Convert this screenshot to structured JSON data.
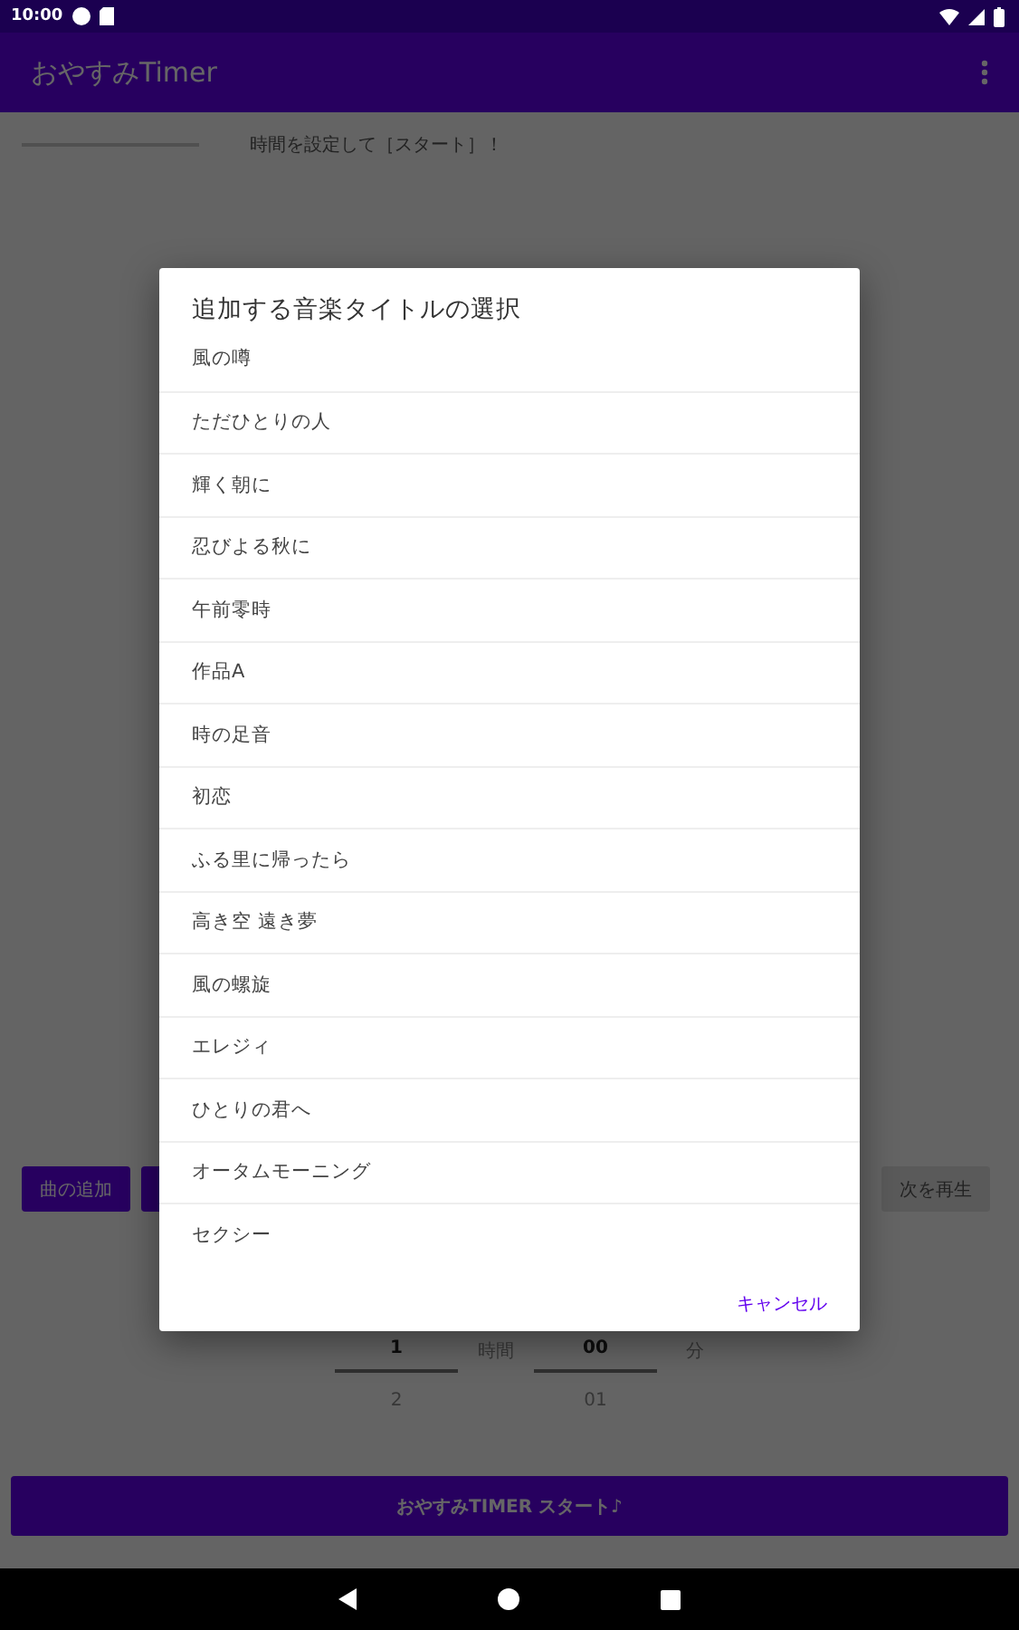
{
  "status_bar": {
    "time": "10:00"
  },
  "app_bar": {
    "title": "おやすみTimer"
  },
  "progress": {
    "level": 0,
    "message": "時間を設定して［スタート］！"
  },
  "buttons": [
    {
      "label": "曲の追加",
      "disabled": false
    },
    {
      "label": "次を再生",
      "disabled": true
    }
  ],
  "time_picker": {
    "hours": {
      "selected": "1",
      "next": "2",
      "unit": "時間"
    },
    "minutes": {
      "selected": "00",
      "next": "01",
      "unit": "分"
    }
  },
  "start_button": {
    "label": "おやすみTIMER スタート♪"
  },
  "dialog": {
    "title": "追加する音楽タイトルの選択",
    "items": [
      "風の噂",
      "ただひとりの人",
      "輝く朝に",
      "忍びよる秋に",
      "午前零時",
      "作品A",
      "時の足音",
      "初恋",
      "ふる里に帰ったら",
      "高き空 遠き夢",
      "風の螺旋",
      "エレジィ",
      "ひとりの君へ",
      "オータムモーニング",
      "セクシー"
    ],
    "cancel": "キャンセル"
  }
}
